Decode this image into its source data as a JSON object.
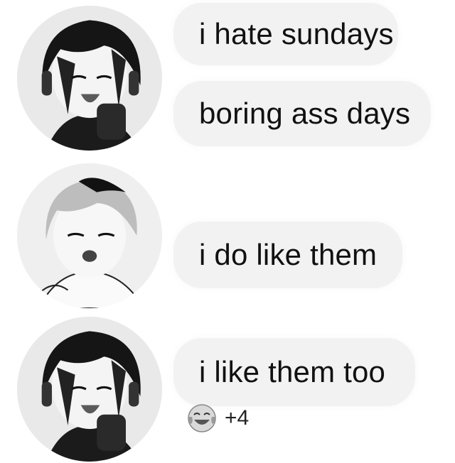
{
  "messages": [
    {
      "sender": "user-a",
      "text": "i hate sundays"
    },
    {
      "sender": "user-a",
      "text": "boring ass days"
    },
    {
      "sender": "user-b",
      "text": "i do like them"
    },
    {
      "sender": "user-a",
      "text": "i like them too"
    }
  ],
  "reaction": {
    "emoji": "face-with-tears-of-joy-icon",
    "count": "+4"
  },
  "colors": {
    "bubble": "#f2f2f2",
    "text": "#111111",
    "background": "#ffffff"
  }
}
